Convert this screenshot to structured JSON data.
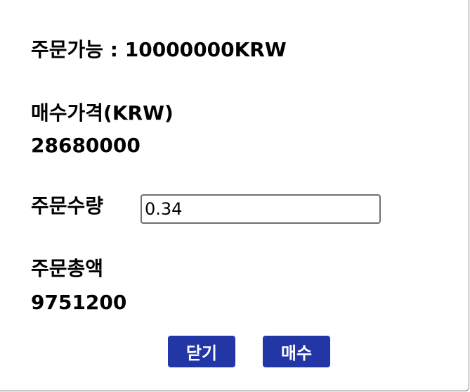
{
  "available": {
    "label": "주문가능",
    "separator": " : ",
    "amount": "10000000",
    "currency": "KRW"
  },
  "price": {
    "label": "매수가격(KRW)",
    "value": "28680000"
  },
  "quantity": {
    "label": "주문수량",
    "value": "0.34"
  },
  "total": {
    "label": "주문총액",
    "value": "9751200"
  },
  "buttons": {
    "close_label": "닫기",
    "buy_label": "매수"
  },
  "colors": {
    "button_background": "#2336a6",
    "button_text": "#ffffff"
  }
}
